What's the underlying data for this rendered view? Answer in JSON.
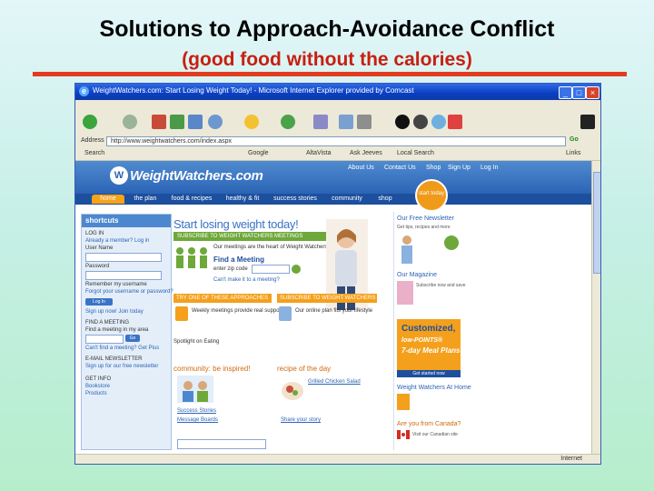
{
  "slide": {
    "title": "Solutions to Approach-Avoidance Conflict",
    "subtitle": "(good food without the calories)"
  },
  "browser": {
    "window_title": "WeightWatchers.com: Start Losing Weight Today! - Microsoft Internet Explorer provided by Comcast",
    "address_label": "Address",
    "url": "http://www.weightwatchers.com/index.aspx",
    "go_label": "Go",
    "links_bar": [
      "Search",
      "Google",
      "AltaVista",
      "Ask Jeeves",
      "Local Search",
      "Links"
    ],
    "status_text": "Internet"
  },
  "site": {
    "logo_text": "WeightWatchers.com",
    "top_links": [
      "About Us",
      "Contact Us",
      "Shop",
      "Sign Up",
      "Log In"
    ],
    "nav": [
      "home",
      "the plan",
      "food & recipes",
      "healthy & fit",
      "success stories",
      "community",
      "shop"
    ],
    "start_badge": "start today",
    "shortcuts": {
      "heading": "shortcuts",
      "login_title": "LOG IN",
      "member_link": "Already a member? Log in",
      "username_label": "User Name",
      "password_label": "Password",
      "remember_label": "Remember my username",
      "forgot_link": "Forgot your username or password?",
      "login_button": "Log In",
      "signup_link": "Sign up now! Join today",
      "find_meeting_title": "FIND A MEETING",
      "zip_label": "Find a meeting in my area",
      "meeting_button": "Go",
      "meeting_link": "Can't find a meeting? Get Plus",
      "newsletter_title": "E-MAIL NEWSLETTER",
      "newsletter_text": "Sign up for our free newsletter",
      "topics_title": "GET INFO",
      "topics": [
        "Bookstore",
        "Products"
      ]
    },
    "hero": {
      "title": "Start losing weight today!",
      "meetings_bar": "SUBSCRIBE TO WEIGHT WATCHERS MEETINGS",
      "meetings_text": "Our meetings are the heart of Weight Watchers.",
      "find_meeting": "Find a Meeting",
      "zip_label": "enter zip code",
      "online_link": "Can't make it to a meeting?"
    },
    "promos": [
      {
        "bar": "TRY ONE OF THESE APPROACHES",
        "text": "Weekly meetings provide real support"
      },
      {
        "bar": "SUBSCRIBE TO WEIGHT WATCHERS ONLINE",
        "text": "Our online plan fits your lifestyle"
      }
    ],
    "sections": {
      "welcome": "Spotlight on Eating",
      "community_title": "community: be inspired!",
      "recipe_title": "recipe of the day",
      "recipe_link": "Grilled Chicken Salad",
      "community_links": [
        "Success Stories",
        "Message Boards"
      ],
      "more_link": "Share your story"
    },
    "right": {
      "newsletter_title": "Our Free Newsletter",
      "newsletter_text": "Get tips, recipes and more",
      "magazine_title": "Our Magazine",
      "magazine_text": "Subscribe now and save",
      "mealplan_line1": "Customized,",
      "mealplan_line2": "low-POINTS®",
      "mealplan_line3": "7-day Meal Plans",
      "mealplan_cta": "Get started now",
      "at_home_title": "Weight Watchers At Home",
      "canada_title": "Are you from Canada?",
      "canada_text": "Visit our Canadian site"
    }
  }
}
